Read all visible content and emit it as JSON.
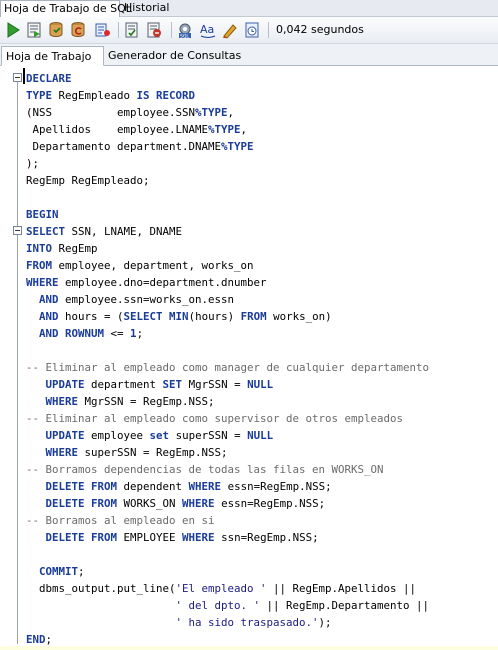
{
  "top_tabs": [
    {
      "label": "Hoja de Trabajo de SQL",
      "active": true
    },
    {
      "label": "Historial",
      "active": false
    }
  ],
  "toolbar": {
    "buttons": [
      "run-statement-icon",
      "run-script-icon",
      "commit-icon",
      "rollback-icon",
      "sql-tuning-icon",
      "explain-plan-icon",
      "autotrace-icon",
      "sql-tuning-advisor-icon",
      "uppercase-icon",
      "clear-icon",
      "history-icon"
    ],
    "timing": "0,042 segundos"
  },
  "sub_tabs": [
    {
      "label": "Hoja de Trabajo",
      "active": true
    },
    {
      "label": "Generador de Consultas",
      "active": false
    }
  ],
  "colors": {
    "keyword": "#1a3c99",
    "comment": "#6b6b6b",
    "string": "#1b1b86",
    "current_line": "#fcfcd8"
  },
  "code_lines": [
    [
      {
        "t": "DECLARE",
        "c": "kw"
      }
    ],
    [
      {
        "t": "TYPE",
        "c": "kw"
      },
      {
        "t": " RegEmpleado ",
        "c": "tx"
      },
      {
        "t": "IS RECORD",
        "c": "kw"
      }
    ],
    [
      {
        "t": "(NSS          employee.SSN",
        "c": "tx"
      },
      {
        "t": "%TYPE",
        "c": "kw"
      },
      {
        "t": ",",
        "c": "tx"
      }
    ],
    [
      {
        "t": " Apellidos    employee.LNAME",
        "c": "tx"
      },
      {
        "t": "%TYPE",
        "c": "kw"
      },
      {
        "t": ",",
        "c": "tx"
      }
    ],
    [
      {
        "t": " Departamento department.DNAME",
        "c": "tx"
      },
      {
        "t": "%TYPE",
        "c": "kw"
      }
    ],
    [
      {
        "t": ");",
        "c": "tx"
      }
    ],
    [
      {
        "t": "RegEmp RegEmpleado;",
        "c": "tx"
      }
    ],
    [
      {
        "t": "",
        "c": "tx"
      }
    ],
    [
      {
        "t": "BEGIN",
        "c": "kw"
      }
    ],
    [
      {
        "t": "SELECT",
        "c": "kw"
      },
      {
        "t": " SSN, LNAME, DNAME",
        "c": "tx"
      }
    ],
    [
      {
        "t": "INTO",
        "c": "kw"
      },
      {
        "t": " RegEmp",
        "c": "tx"
      }
    ],
    [
      {
        "t": "FROM",
        "c": "kw"
      },
      {
        "t": " employee, department, works_on",
        "c": "tx"
      }
    ],
    [
      {
        "t": "WHERE",
        "c": "kw"
      },
      {
        "t": " employee.dno=department.dnumber",
        "c": "tx"
      }
    ],
    [
      {
        "t": "  ",
        "c": "tx"
      },
      {
        "t": "AND",
        "c": "kw"
      },
      {
        "t": " employee.ssn=works_on.essn",
        "c": "tx"
      }
    ],
    [
      {
        "t": "  ",
        "c": "tx"
      },
      {
        "t": "AND",
        "c": "kw"
      },
      {
        "t": " hours = (",
        "c": "tx"
      },
      {
        "t": "SELECT MIN",
        "c": "kw"
      },
      {
        "t": "(hours) ",
        "c": "tx"
      },
      {
        "t": "FROM",
        "c": "kw"
      },
      {
        "t": " works_on)",
        "c": "tx"
      }
    ],
    [
      {
        "t": "  ",
        "c": "tx"
      },
      {
        "t": "AND ROWNUM",
        "c": "kw"
      },
      {
        "t": " <= ",
        "c": "tx"
      },
      {
        "t": "1",
        "c": "kw"
      },
      {
        "t": ";",
        "c": "tx"
      }
    ],
    [
      {
        "t": "",
        "c": "tx"
      }
    ],
    [
      {
        "t": "-- Eliminar al empleado como manager de cualquier departamento",
        "c": "cm"
      }
    ],
    [
      {
        "t": "   ",
        "c": "tx"
      },
      {
        "t": "UPDATE",
        "c": "kw"
      },
      {
        "t": " department ",
        "c": "tx"
      },
      {
        "t": "SET",
        "c": "kw"
      },
      {
        "t": " MgrSSN = ",
        "c": "tx"
      },
      {
        "t": "NULL",
        "c": "kw"
      }
    ],
    [
      {
        "t": "   ",
        "c": "tx"
      },
      {
        "t": "WHERE",
        "c": "kw"
      },
      {
        "t": " MgrSSN = RegEmp.NSS;",
        "c": "tx"
      }
    ],
    [
      {
        "t": "-- Eliminar al empleado como supervisor de otros empleados",
        "c": "cm"
      }
    ],
    [
      {
        "t": "   ",
        "c": "tx"
      },
      {
        "t": "UPDATE",
        "c": "kw"
      },
      {
        "t": " employee ",
        "c": "tx"
      },
      {
        "t": "set",
        "c": "kw"
      },
      {
        "t": " superSSN = ",
        "c": "tx"
      },
      {
        "t": "NULL",
        "c": "kw"
      }
    ],
    [
      {
        "t": "   ",
        "c": "tx"
      },
      {
        "t": "WHERE",
        "c": "kw"
      },
      {
        "t": " superSSN = RegEmp.NSS;",
        "c": "tx"
      }
    ],
    [
      {
        "t": "-- Borramos dependencias de todas las filas en WORKS_ON",
        "c": "cm"
      }
    ],
    [
      {
        "t": "   ",
        "c": "tx"
      },
      {
        "t": "DELETE FROM",
        "c": "kw"
      },
      {
        "t": " dependent ",
        "c": "tx"
      },
      {
        "t": "WHERE",
        "c": "kw"
      },
      {
        "t": " essn=RegEmp.NSS;",
        "c": "tx"
      }
    ],
    [
      {
        "t": "   ",
        "c": "tx"
      },
      {
        "t": "DELETE FROM",
        "c": "kw"
      },
      {
        "t": " WORKS_ON ",
        "c": "tx"
      },
      {
        "t": "WHERE",
        "c": "kw"
      },
      {
        "t": " essn=RegEmp.NSS;",
        "c": "tx"
      }
    ],
    [
      {
        "t": "-- Borramos al empleado en si",
        "c": "cm"
      }
    ],
    [
      {
        "t": "   ",
        "c": "tx"
      },
      {
        "t": "DELETE FROM",
        "c": "kw"
      },
      {
        "t": " EMPLOYEE ",
        "c": "tx"
      },
      {
        "t": "WHERE",
        "c": "kw"
      },
      {
        "t": " ssn=RegEmp.NSS;",
        "c": "tx"
      }
    ],
    [
      {
        "t": "",
        "c": "tx"
      }
    ],
    [
      {
        "t": "  ",
        "c": "tx"
      },
      {
        "t": "COMMIT",
        "c": "kw"
      },
      {
        "t": ";",
        "c": "tx"
      }
    ],
    [
      {
        "t": "  dbms_output.put_line(",
        "c": "tx"
      },
      {
        "t": "'El empleado '",
        "c": "st"
      },
      {
        "t": " || RegEmp.Apellidos ||",
        "c": "tx"
      }
    ],
    [
      {
        "t": "                       ",
        "c": "tx"
      },
      {
        "t": "' del dpto. '",
        "c": "st"
      },
      {
        "t": " || RegEmp.Departamento ||",
        "c": "tx"
      }
    ],
    [
      {
        "t": "                       ",
        "c": "tx"
      },
      {
        "t": "' ha sido traspasado.'",
        "c": "st"
      },
      {
        "t": ");",
        "c": "tx"
      }
    ],
    [
      {
        "t": "END",
        "c": "kw"
      },
      {
        "t": ";",
        "c": "tx"
      }
    ]
  ]
}
